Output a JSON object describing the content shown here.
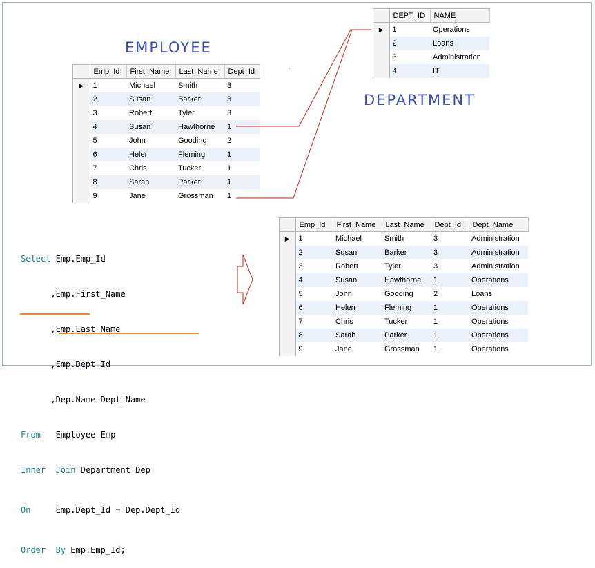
{
  "titles": {
    "employee": "EMPLOYEE",
    "department": "DEPARTMENT"
  },
  "employee_table": {
    "columns": [
      "Emp_Id",
      "First_Name",
      "Last_Name",
      "Dept_Id"
    ],
    "rows": [
      [
        "1",
        "Michael",
        "Smith",
        "3"
      ],
      [
        "2",
        "Susan",
        "Barker",
        "3"
      ],
      [
        "3",
        "Robert",
        "Tyler",
        "3"
      ],
      [
        "4",
        "Susan",
        "Hawthorne",
        "1"
      ],
      [
        "5",
        "John",
        "Gooding",
        "2"
      ],
      [
        "6",
        "Helen",
        "Fleming",
        "1"
      ],
      [
        "7",
        "Chris",
        "Tucker",
        "1"
      ],
      [
        "8",
        "Sarah",
        "Parker",
        "1"
      ],
      [
        "9",
        "Jane",
        "Grossman",
        "1"
      ]
    ]
  },
  "department_table": {
    "columns": [
      "DEPT_ID",
      "NAME"
    ],
    "rows": [
      [
        "1",
        "Operations"
      ],
      [
        "2",
        "Loans"
      ],
      [
        "3",
        "Administration"
      ],
      [
        "4",
        "IT"
      ]
    ]
  },
  "result_table": {
    "columns": [
      "Emp_Id",
      "First_Name",
      "Last_Name",
      "Dept_Id",
      "Dept_Name"
    ],
    "rows": [
      [
        "1",
        "Michael",
        "Smith",
        "3",
        "Administration"
      ],
      [
        "2",
        "Susan",
        "Barker",
        "3",
        "Administration"
      ],
      [
        "3",
        "Robert",
        "Tyler",
        "3",
        "Administration"
      ],
      [
        "4",
        "Susan",
        "Hawthorne",
        "1",
        "Operations"
      ],
      [
        "5",
        "John",
        "Gooding",
        "2",
        "Loans"
      ],
      [
        "6",
        "Helen",
        "Fleming",
        "1",
        "Operations"
      ],
      [
        "7",
        "Chris",
        "Tucker",
        "1",
        "Operations"
      ],
      [
        "8",
        "Sarah",
        "Parker",
        "1",
        "Operations"
      ],
      [
        "9",
        "Jane",
        "Grossman",
        "1",
        "Operations"
      ]
    ]
  },
  "sql": {
    "select_kw": "Select",
    "select_first": "Emp.Emp_Id",
    "select_cols": [
      ",Emp.First_Name",
      ",Emp.Last_Name",
      ",Emp.Dept_Id",
      ",Dep.Name Dept_Name"
    ],
    "from_kw": "From",
    "from_rest": "Employee Emp",
    "inner_kw": "Inner",
    "join_kw": "Join",
    "join_rest": "Department Dep",
    "on_kw": "On",
    "on_rest": "Emp.Dept_Id = Dep.Dept_Id",
    "order_kw": "Order",
    "by_kw": "By",
    "order_rest": "Emp.Emp_Id;"
  },
  "colors": {
    "title": "#3b4fb8",
    "connector": "#cc2222",
    "underline": "#f08a24",
    "keyword": "#1a8585",
    "row_alt": "#eaf1fb"
  },
  "icons": [
    "row-selector-arrow-icon",
    "hollow-right-arrow-icon"
  ]
}
